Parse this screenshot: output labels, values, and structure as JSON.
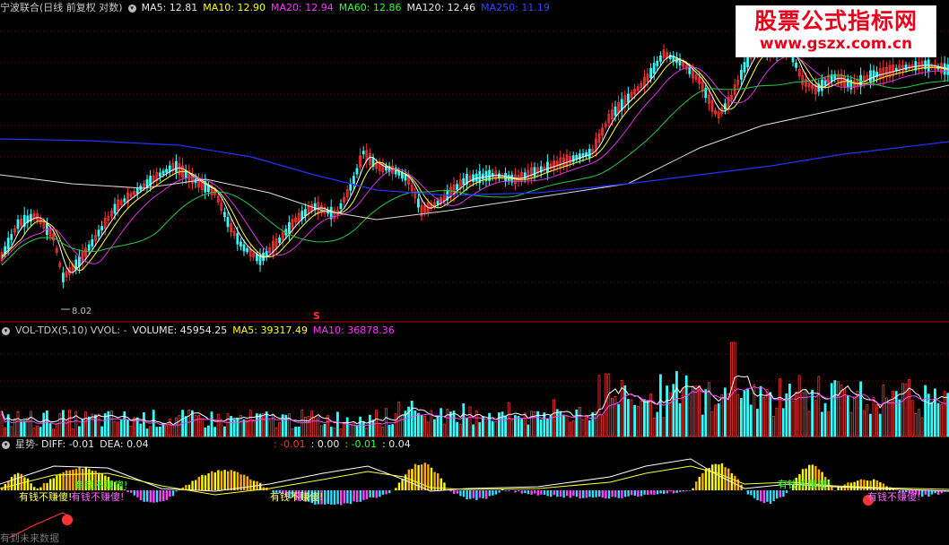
{
  "main_panel": {
    "name": "宁波联合(日线 前复权 对数)",
    "indicators": [
      {
        "label": "MA5: 12.81",
        "color": "#e8e8e8"
      },
      {
        "label": "MA10: 12.90",
        "color": "#ffff00"
      },
      {
        "label": "MA20: 12.94",
        "color": "#ff33ff"
      },
      {
        "label": "MA60: 12.86",
        "color": "#33ff33"
      },
      {
        "label": "MA120: 12.46",
        "color": "#e8e8e8"
      },
      {
        "label": "MA250: 11.19",
        "color": "#3333ff"
      }
    ],
    "min_label": "8.02",
    "marker": "S"
  },
  "vol_panel": {
    "name": "VOL-TDX(5,10)",
    "vvol": "VVOL: -",
    "indicators": [
      {
        "label": "VOLUME: 45954.25",
        "color": "#e8e8e8"
      },
      {
        "label": "MA5: 39317.49",
        "color": "#ffff00"
      },
      {
        "label": "MA10: 36878.36",
        "color": "#ff33ff"
      }
    ]
  },
  "osc_panel": {
    "name": "星势-",
    "indicators": [
      {
        "label": "DIFF: -0.01",
        "color": "#e8e8e8"
      },
      {
        "label": "DEA: 0.04",
        "color": "#e8e8e8"
      }
    ],
    "extra": [
      {
        "label": ": -0.01",
        "color": "#ff3333"
      },
      {
        "label": ": 0.00",
        "color": "#e8e8e8"
      },
      {
        "label": ": -0.01",
        "color": "#33ff33"
      },
      {
        "label": ": 0.04",
        "color": "#e8e8e8"
      }
    ],
    "tag_text": "有钱不赚傻!",
    "future_text": "有到未来数据"
  },
  "watermark": {
    "title": "股票公式指标网",
    "url": "www.gszx.com.cn"
  },
  "colors": {
    "up": "#ff3333",
    "down": "#33ffff",
    "grid": "#800000",
    "ma250": "#2233ff",
    "ma60": "#22cc44",
    "ma20": "#dd33dd",
    "ma120": "#dddddd"
  }
}
